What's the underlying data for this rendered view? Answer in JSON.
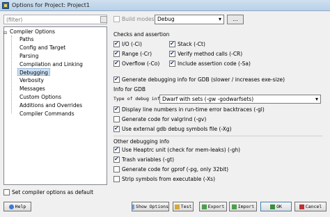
{
  "window": {
    "title": "Options for Project: Project1"
  },
  "filter": {
    "placeholder": "(filter)"
  },
  "tree": {
    "root": "Compiler Options",
    "children": [
      "Paths",
      "Config and Target",
      "Parsing",
      "Compilation and Linking",
      "Debugging",
      "Verbosity",
      "Messages",
      "Custom Options",
      "Additions and Overrides",
      "Compiler Commands"
    ],
    "selected": "Debugging"
  },
  "set_default": {
    "label": "Set compiler options as default",
    "checked": false
  },
  "build_modes": {
    "label": "Build modes",
    "checked": false,
    "value": "Debug",
    "dots": "..."
  },
  "checks": {
    "title": "Checks and assertion",
    "items": [
      {
        "label": "I/O (-Ci)",
        "checked": true
      },
      {
        "label": "Range (-Cr)",
        "checked": true
      },
      {
        "label": "Overflow (-Co)",
        "checked": true
      },
      {
        "label": "Stack (-Ct)",
        "checked": true
      },
      {
        "label": "Verify method calls (-CR)",
        "checked": true
      },
      {
        "label": "Include assertion code (-Sa)",
        "checked": true
      }
    ]
  },
  "gdb_generate": {
    "label": "Generate debugging info for GDB (slower / increases exe-size)",
    "checked": true
  },
  "gdb": {
    "title": "Info for GDB",
    "type_label": "Type of debug info",
    "type_value": "Dwarf with sets (-gw -godwarfsets)",
    "items": [
      {
        "label": "Display line numbers in run-time error backtraces (-gl)",
        "checked": true
      },
      {
        "label": "Generate code for valgrind (-gv)",
        "checked": false
      },
      {
        "label": "Use external gdb debug symbols file (-Xg)",
        "checked": true
      }
    ]
  },
  "other": {
    "title": "Other debugging info",
    "items": [
      {
        "label": "Use Heaptrc unit (check for mem-leaks) (-gh)",
        "checked": true
      },
      {
        "label": "Trash variables (-gt)",
        "checked": true
      },
      {
        "label": "Generate code for gprof (-pg, only 32bit)",
        "checked": false
      },
      {
        "label": "Strip symbols from executable (-Xs)",
        "checked": false
      }
    ]
  },
  "buttons": {
    "help": "Help",
    "show_options": "Show Options",
    "test": "Test",
    "export": "Export",
    "import": "Import",
    "ok": "OK",
    "cancel": "Cancel"
  },
  "icons": {
    "app": "application-icon",
    "help": "help-icon",
    "show_options": "options-icon",
    "test": "test-icon",
    "export": "export-icon",
    "import": "import-icon",
    "ok": "check-icon",
    "cancel": "cancel-icon"
  }
}
